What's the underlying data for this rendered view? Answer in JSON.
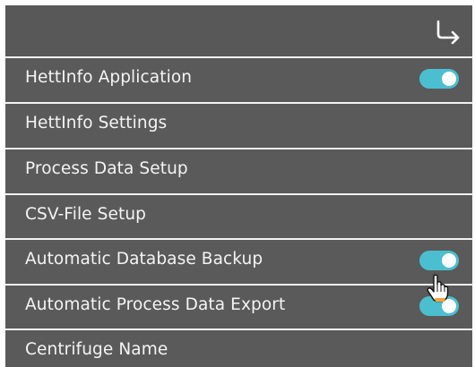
{
  "header": {
    "back_icon": "return-arrow-icon"
  },
  "menu": {
    "items": [
      {
        "label": "HettInfo Application",
        "toggle": true,
        "toggle_on": true
      },
      {
        "label": "HettInfo Settings",
        "toggle": false
      },
      {
        "label": "Process Data Setup",
        "toggle": false
      },
      {
        "label": "CSV-File Setup",
        "toggle": false
      },
      {
        "label": "Automatic Database Backup",
        "toggle": true,
        "toggle_on": true
      },
      {
        "label": "Automatic Process Data Export",
        "toggle": true,
        "toggle_on": true
      },
      {
        "label": "Centrifuge Name",
        "toggle": false
      }
    ]
  },
  "colors": {
    "panel_bg": "#5a5a5a",
    "divider": "#f2f2f2",
    "text": "#f4f4f4",
    "toggle_on": "#4bbfcf"
  },
  "cursor": {
    "icon": "hand-pointer-icon"
  }
}
